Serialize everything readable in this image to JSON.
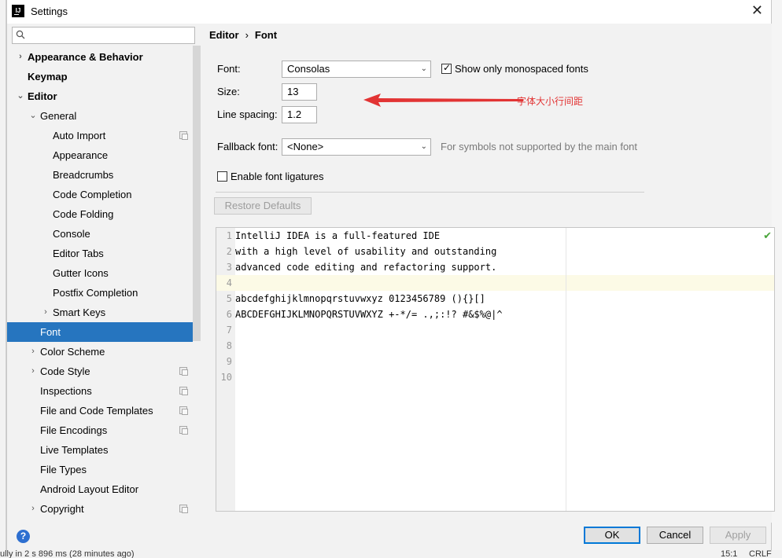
{
  "window": {
    "title": "Settings",
    "close_icon": "close-icon"
  },
  "search": {
    "placeholder": "",
    "icon": "search-icon"
  },
  "breadcrumb": {
    "parent": "Editor",
    "separator": "›",
    "current": "Font"
  },
  "tree": [
    {
      "label": "Appearance & Behavior",
      "chevron": "›",
      "bold": true
    },
    {
      "label": "Keymap",
      "bold": true
    },
    {
      "label": "Editor",
      "chevron": "⌄",
      "bold": true
    },
    {
      "label": "General",
      "chevron": "⌄"
    },
    {
      "label": "Auto Import",
      "copy": true
    },
    {
      "label": "Appearance"
    },
    {
      "label": "Breadcrumbs"
    },
    {
      "label": "Code Completion"
    },
    {
      "label": "Code Folding"
    },
    {
      "label": "Console"
    },
    {
      "label": "Editor Tabs"
    },
    {
      "label": "Gutter Icons"
    },
    {
      "label": "Postfix Completion"
    },
    {
      "label": "Smart Keys",
      "chevron": "›"
    },
    {
      "label": "Font",
      "selected": true
    },
    {
      "label": "Color Scheme",
      "chevron": "›"
    },
    {
      "label": "Code Style",
      "chevron": "›",
      "copy": true
    },
    {
      "label": "Inspections",
      "copy": true
    },
    {
      "label": "File and Code Templates",
      "copy": true
    },
    {
      "label": "File Encodings",
      "copy": true
    },
    {
      "label": "Live Templates"
    },
    {
      "label": "File Types"
    },
    {
      "label": "Android Layout Editor"
    },
    {
      "label": "Copyright",
      "chevron": "›",
      "copy": true
    }
  ],
  "font_settings": {
    "font_label": "Font:",
    "font_value": "Consolas",
    "monospaced_checkbox_label": "Show only monospaced fonts",
    "monospaced_checked": true,
    "size_label": "Size:",
    "size_value": "13",
    "line_spacing_label": "Line spacing:",
    "line_spacing_value": "1.2",
    "fallback_label": "Fallback font:",
    "fallback_value": "<None>",
    "fallback_hint": "For symbols not supported by the main font",
    "ligatures_label": "Enable font ligatures",
    "ligatures_checked": false,
    "restore_defaults_label": "Restore Defaults"
  },
  "annotation": {
    "text": "字体大小行间距",
    "color": "#e23434"
  },
  "preview": {
    "lines": [
      {
        "number": "1",
        "text": "IntelliJ IDEA is a full-featured IDE"
      },
      {
        "number": "2",
        "text": "with a high level of usability and outstanding"
      },
      {
        "number": "3",
        "text": "advanced code editing and refactoring support."
      },
      {
        "number": "4",
        "text": "",
        "current": true
      },
      {
        "number": "5",
        "text": "abcdefghijklmnopqrstuvwxyz 0123456789 (){}[]"
      },
      {
        "number": "6",
        "text": "ABCDEFGHIJKLMNOPQRSTUVWXYZ +-*/= .,;:!? #&$%@|^"
      },
      {
        "number": "7",
        "text": ""
      },
      {
        "number": "8",
        "text": ""
      },
      {
        "number": "9",
        "text": ""
      },
      {
        "number": "10",
        "text": ""
      }
    ],
    "status_icon": "checkmark-icon"
  },
  "buttons": {
    "help": "?",
    "ok": "OK",
    "cancel": "Cancel",
    "apply": "Apply"
  },
  "background_ide": {
    "bottom_status": "ully in 2 s 896 ms (28 minutes ago)",
    "position": "15:1",
    "line_ending": "CRLF"
  },
  "colors": {
    "selection": "#2675bf",
    "accent": "#0078d7",
    "annotation": "#e23434"
  }
}
